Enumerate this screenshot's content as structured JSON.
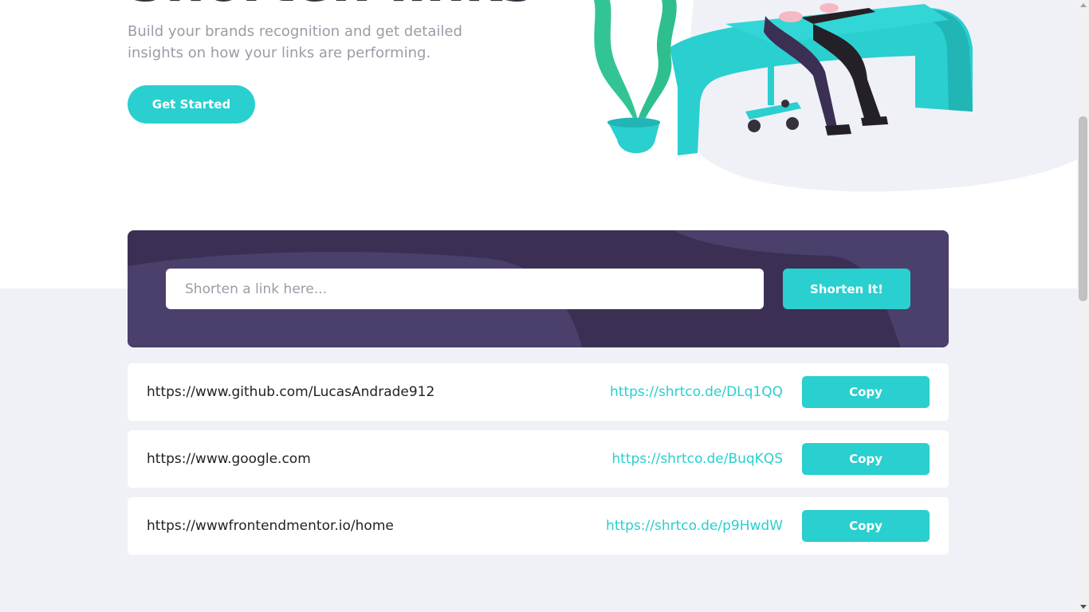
{
  "hero": {
    "title": "Shorten links",
    "subtitle": "Build your brands recognition and get detailed insights on how your links are performing.",
    "cta_label": "Get Started",
    "illustration": "person-working-at-desk-illustration"
  },
  "shortener": {
    "input_placeholder": "Shorten a link here...",
    "input_value": "",
    "button_label": "Shorten It!"
  },
  "results": [
    {
      "original": "https://www.github.com/LucasAndrade912",
      "short": "https://shrtco.de/DLq1QQ",
      "button_label": "Copy"
    },
    {
      "original": "https://www.google.com",
      "short": "https://shrtco.de/BuqKQS",
      "button_label": "Copy"
    },
    {
      "original": "https://wwwfrontendmentor.io/home",
      "short": "https://shrtco.de/p9HwdW",
      "button_label": "Copy"
    }
  ],
  "colors": {
    "cyan": "#2acfcf",
    "dark_violet": "#3b3054",
    "light_violet": "#4b3f6b",
    "gray_background": "#eff1f7",
    "gray_text": "#9e9aa7",
    "dark_text": "#34313d"
  }
}
